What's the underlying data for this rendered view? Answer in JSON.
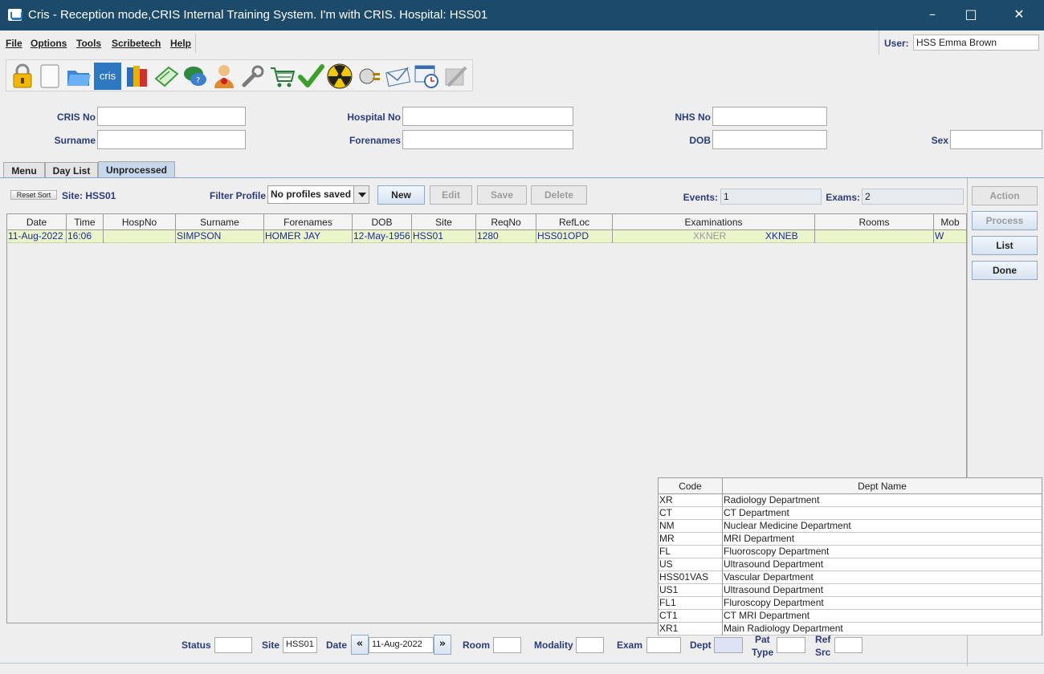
{
  "window": {
    "title": "Cris - Reception mode,CRIS Internal Training System. I'm with CRIS.   Hospital: HSS01"
  },
  "menu": {
    "items": [
      "File",
      "Options",
      "Tools",
      "Scribetech",
      "Help"
    ]
  },
  "user": {
    "label": "User:",
    "value": "HSS Emma Brown"
  },
  "toolbar": {
    "icons": [
      "lock-icon",
      "blank-page-icon",
      "open-folder-icon",
      "cris-logo-icon",
      "books-icon",
      "notebook-icon",
      "chat-icon",
      "user-info-icon",
      "wrench-icon",
      "shopping-cart-icon",
      "green-tick-icon",
      "radiation-icon",
      "plug-icon",
      "envelope-icon",
      "clock-window-icon",
      "disabled-tool-icon"
    ],
    "cris_label": "cris"
  },
  "search": {
    "cris_no": "CRIS No",
    "hospital_no": "Hospital No",
    "nhs_no": "NHS No",
    "surname": "Surname",
    "forenames": "Forenames",
    "dob": "DOB",
    "sex": "Sex"
  },
  "tabs": [
    "Menu",
    "Day List",
    "Unprocessed"
  ],
  "active_tab": "Unprocessed",
  "controls": {
    "reset_sort": "Reset Sort",
    "site_label": "Site: HSS01",
    "filter_profile_label": "Filter Profile",
    "filter_profile_value": "No profiles saved",
    "new": "New",
    "edit": "Edit",
    "save": "Save",
    "delete": "Delete",
    "events_label": "Events:",
    "events_value": "1",
    "exams_label": "Exams:",
    "exams_value": "2"
  },
  "side_buttons": {
    "action": "Action",
    "process": "Process",
    "list": "List",
    "done": "Done"
  },
  "grid": {
    "columns": [
      "Date",
      "Time",
      "HospNo",
      "Surname",
      "Forenames",
      "DOB",
      "Site",
      "ReqNo",
      "RefLoc",
      "Examinations",
      "Rooms",
      "Mob"
    ],
    "rows": [
      {
        "date": "11-Aug-2022",
        "time": "16:06",
        "hospno": "",
        "surname": "SIMPSON",
        "forenames": "HOMER JAY",
        "dob": "12-May-1956",
        "site": "HSS01",
        "reqno": "1280",
        "refloc": "HSS01OPD",
        "exam1": "XKNER",
        "exam2": "XKNEB",
        "rooms": "",
        "mob": "W"
      }
    ]
  },
  "dept_popup": {
    "columns": [
      "Code",
      "Dept Name"
    ],
    "rows": [
      {
        "code": "XR",
        "name": "Radiology Department"
      },
      {
        "code": "CT",
        "name": "CT Department"
      },
      {
        "code": "NM",
        "name": "Nuclear Medicine Department"
      },
      {
        "code": "MR",
        "name": "MRI Department"
      },
      {
        "code": "FL",
        "name": "Fluoroscopy Department"
      },
      {
        "code": "US",
        "name": "Ultrasound Department"
      },
      {
        "code": "HSS01VAS",
        "name": "Vascular Department"
      },
      {
        "code": "US1",
        "name": "Ultrasound Department"
      },
      {
        "code": "FL1",
        "name": "Fluroscopy Department"
      },
      {
        "code": "CT1",
        "name": "CT MRI Department"
      },
      {
        "code": "XR1",
        "name": "Main Radiology Department"
      }
    ]
  },
  "footer": {
    "status": "Status",
    "site": "Site",
    "site_value": "HSS01",
    "date": "Date",
    "date_value": "11-Aug-2022",
    "room": "Room",
    "modality": "Modality",
    "exam": "Exam",
    "dept": "Dept",
    "pat_type_1": "Pat",
    "pat_type_2": "Type",
    "ref_src_1": "Ref",
    "ref_src_2": "Src"
  },
  "colors": {
    "titlebar": "#1b4a6b",
    "label_blue": "#2b3c7a",
    "row_highlight": "#eaf5c9",
    "row_text": "#1d2a9e",
    "active_tab": "#c6d8ea"
  }
}
